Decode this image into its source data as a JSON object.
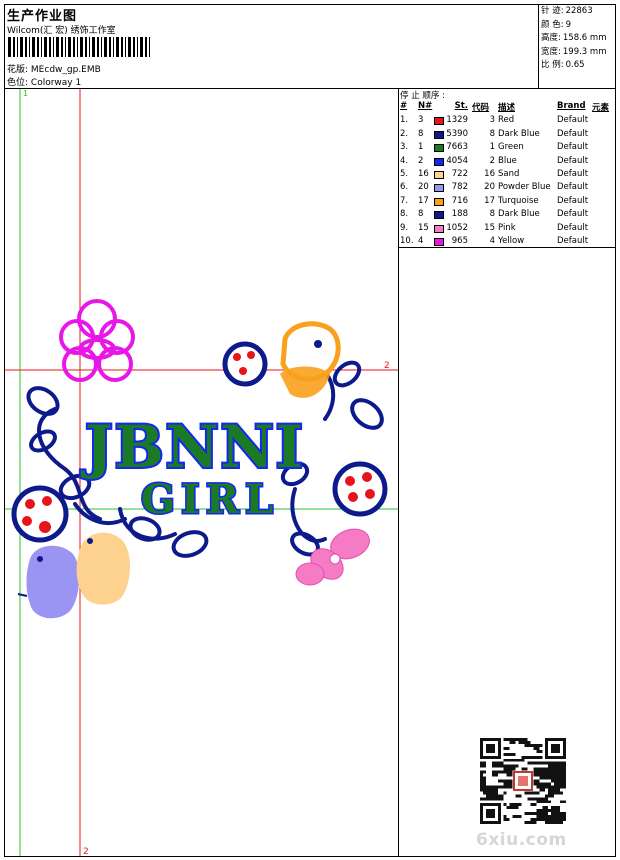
{
  "header": {
    "title": "生产作业图",
    "subtitle": "Wilcom(汇 宏) 绣饰工作室",
    "design_label": "花版:",
    "design_value": "MEcdw_gp.EMB",
    "colorway_label": "色位:",
    "colorway_value": "Colorway 1"
  },
  "stats": [
    {
      "label": "针 迹:",
      "value": "22863"
    },
    {
      "label": "颜 色:",
      "value": "9"
    },
    {
      "label": "高度:",
      "value": "158.6 mm"
    },
    {
      "label": "宽度:",
      "value": "199.3 mm"
    },
    {
      "label": "比 例:",
      "value": "0.65"
    }
  ],
  "stop_sequence": {
    "title": "停 止 顺序 :",
    "headers": {
      "idx": "#",
      "n": "N#",
      "st": "St.",
      "code": "代码",
      "desc": "描述",
      "brand": "Brand",
      "element": "元素"
    },
    "rows": [
      {
        "idx": "1.",
        "n": "3",
        "color": "#e8141b",
        "st": "1329",
        "code": "3",
        "desc": "Red",
        "brand": "Default"
      },
      {
        "idx": "2.",
        "n": "8",
        "color": "#0c1a8c",
        "st": "5390",
        "code": "8",
        "desc": "Dark Blue",
        "brand": "Default"
      },
      {
        "idx": "3.",
        "n": "1",
        "color": "#1b7a25",
        "st": "7663",
        "code": "1",
        "desc": "Green",
        "brand": "Default"
      },
      {
        "idx": "4.",
        "n": "2",
        "color": "#1426f0",
        "st": "4054",
        "code": "2",
        "desc": "Blue",
        "brand": "Default"
      },
      {
        "idx": "5.",
        "n": "16",
        "color": "#fdd28f",
        "st": "722",
        "code": "16",
        "desc": "Sand",
        "brand": "Default"
      },
      {
        "idx": "6.",
        "n": "20",
        "color": "#9a94f2",
        "st": "782",
        "code": "20",
        "desc": "Powder Blue",
        "brand": "Default"
      },
      {
        "idx": "7.",
        "n": "17",
        "color": "#f9a11c",
        "st": "716",
        "code": "17",
        "desc": "Turquoise",
        "brand": "Default"
      },
      {
        "idx": "8.",
        "n": "8",
        "color": "#0c1a8c",
        "st": "188",
        "code": "8",
        "desc": "Dark Blue",
        "brand": "Default"
      },
      {
        "idx": "9.",
        "n": "15",
        "color": "#f57bc4",
        "st": "1052",
        "code": "15",
        "desc": "Pink",
        "brand": "Default"
      },
      {
        "idx": "10.",
        "n": "4",
        "color": "#e816e8",
        "st": "965",
        "code": "4",
        "desc": "Yellow",
        "brand": "Default"
      }
    ]
  },
  "design": {
    "text_line1": "JBNNI",
    "text_line2": "GIRL",
    "guide_v1_label": "1",
    "guide_v2_label": "2",
    "guide_h_label": "2"
  },
  "watermark": "6xiu.com"
}
